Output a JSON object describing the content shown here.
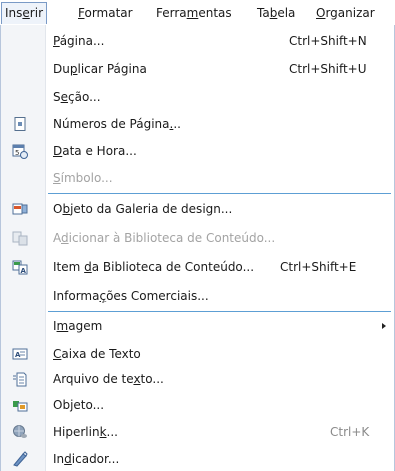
{
  "menubar": {
    "items": [
      {
        "pre": "Ins",
        "ul": "e",
        "post": "rir"
      },
      {
        "pre": "",
        "ul": "F",
        "post": "ormatar"
      },
      {
        "pre": "Ferra",
        "ul": "m",
        "post": "entas"
      },
      {
        "pre": "Ta",
        "ul": "b",
        "post": "ela"
      },
      {
        "pre": "",
        "ul": "O",
        "post": "rganizar"
      }
    ]
  },
  "menu": {
    "items": [
      {
        "pre": "",
        "ul": "P",
        "post": "ágina...",
        "shortcut": "Ctrl+Shift+N",
        "icon": ""
      },
      {
        "pre": "Du",
        "ul": "p",
        "post": "licar Página",
        "shortcut": "Ctrl+Shift+U",
        "icon": ""
      },
      {
        "pre": "S",
        "ul": "e",
        "post": "ção...",
        "shortcut": "",
        "icon": ""
      },
      {
        "pre": "Números de Página",
        "ul": ".",
        "post": "..",
        "shortcut": "",
        "icon": "page-number-icon"
      },
      {
        "pre": "",
        "ul": "D",
        "post": "ata e Hora...",
        "shortcut": "",
        "icon": "date-time-icon"
      },
      {
        "pre": "",
        "ul": "S",
        "post": "ímbolo...",
        "shortcut": "",
        "icon": ""
      },
      {
        "pre": "O",
        "ul": "b",
        "post": "jeto da Galeria de design...",
        "shortcut": "",
        "icon": "design-gallery-icon"
      },
      {
        "pre": "A",
        "ul": "d",
        "post": "icionar à Biblioteca de Conteúdo...",
        "shortcut": "",
        "icon": "add-to-library-icon"
      },
      {
        "pre": "Item ",
        "ul": "d",
        "post": "a Biblioteca de Conteúdo...",
        "shortcut": "Ctrl+Shift+E",
        "icon": "library-item-icon"
      },
      {
        "pre": "Informa",
        "ul": "ç",
        "post": "ões Comerciais...",
        "shortcut": "",
        "icon": ""
      },
      {
        "pre": "I",
        "ul": "m",
        "post": "agem",
        "shortcut": "",
        "icon": ""
      },
      {
        "pre": "",
        "ul": "C",
        "post": "aixa de Texto",
        "shortcut": "",
        "icon": "text-box-icon"
      },
      {
        "pre": "Arquivo de te",
        "ul": "x",
        "post": "to...",
        "shortcut": "",
        "icon": "text-file-icon"
      },
      {
        "pre": "Objeto...",
        "ul": "",
        "post": "",
        "shortcut": "",
        "icon": "object-icon"
      },
      {
        "pre": "Hiperlin",
        "ul": "k",
        "post": "...",
        "shortcut": "Ctrl+K",
        "icon": "hyperlink-icon"
      },
      {
        "pre": "In",
        "ul": "d",
        "post": "icador...",
        "shortcut": "",
        "icon": "bookmark-icon"
      }
    ]
  },
  "colors": {
    "accent": "#5d9fd4",
    "disabled": "#a3a3a3",
    "gutter": "#f3f5f8"
  }
}
